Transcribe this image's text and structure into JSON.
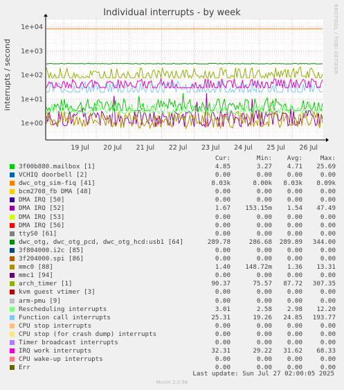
{
  "title": "Individual interrupts - by week",
  "ylabel": "interrupts / second",
  "side_text": "RRDTOOL / TOBI OETIKER",
  "footer": {
    "last_update": "Last update: Sun Jul 27 02:00:05 2025",
    "munin": "Munin 2.0.56"
  },
  "legend_headers": [
    "Cur:",
    "Min:",
    "Avg:",
    "Max:"
  ],
  "chart_data": {
    "type": "line",
    "title": "Individual interrupts - by week",
    "ylabel": "interrupts / second",
    "yscale": "log",
    "ylim": [
      0.2,
      20000
    ],
    "yticks": [
      "1e+00",
      "1e+01",
      "1e+02",
      "1e+03",
      "1e+04"
    ],
    "ytick_values": [
      1,
      10,
      100,
      1000,
      10000
    ],
    "xticks": [
      "19 Jul",
      "20 Jul",
      "21 Jul",
      "22 Jul",
      "23 Jul",
      "24 Jul",
      "25 Jul",
      "26 Jul"
    ],
    "grid": true,
    "series": [
      {
        "name": "3f00b880.mailbox [1]",
        "color": "#00cc00",
        "cur": "4.85",
        "min": "3.27",
        "avg": "4.71",
        "max": "25.69",
        "avg_value": 4.71,
        "min_value": 3.27,
        "max_value": 25.69
      },
      {
        "name": "VCHIQ doorbell [2]",
        "color": "#0066b3",
        "cur": "0.00",
        "min": "0.00",
        "avg": "0.00",
        "max": "0.00",
        "avg_value": 0,
        "min_value": 0,
        "max_value": 0
      },
      {
        "name": "dwc_otg_sim-fiq [41]",
        "color": "#ff8000",
        "cur": "8.03k",
        "min": "8.00k",
        "avg": "8.03k",
        "max": "8.09k",
        "avg_value": 8030,
        "min_value": 8000,
        "max_value": 8090
      },
      {
        "name": "bcm2708_fb DMA [48]",
        "color": "#ffcc00",
        "cur": "0.00",
        "min": "0.00",
        "avg": "0.00",
        "max": "0.00",
        "avg_value": 0,
        "min_value": 0,
        "max_value": 0
      },
      {
        "name": "DMA IRQ [50]",
        "color": "#330099",
        "cur": "0.00",
        "min": "0.00",
        "avg": "0.00",
        "max": "0.00",
        "avg_value": 0,
        "min_value": 0,
        "max_value": 0
      },
      {
        "name": "DMA IRQ [52]",
        "color": "#990099",
        "cur": "1.67",
        "min": "153.15m",
        "avg": "1.54",
        "max": "47.49",
        "avg_value": 1.54,
        "min_value": 0.15315,
        "max_value": 47.49
      },
      {
        "name": "DMA IRQ [53]",
        "color": "#ccff00",
        "cur": "0.00",
        "min": "0.00",
        "avg": "0.00",
        "max": "0.00",
        "avg_value": 0,
        "min_value": 0,
        "max_value": 0
      },
      {
        "name": "DMA IRQ [56]",
        "color": "#ff0000",
        "cur": "0.00",
        "min": "0.00",
        "avg": "0.00",
        "max": "0.00",
        "avg_value": 0,
        "min_value": 0,
        "max_value": 0
      },
      {
        "name": "ttyS0 [61]",
        "color": "#808080",
        "cur": "0.00",
        "min": "0.00",
        "avg": "0.00",
        "max": "0.00",
        "avg_value": 0,
        "min_value": 0,
        "max_value": 0
      },
      {
        "name": "dwc_otg, dwc_otg_pcd, dwc_otg_hcd:usb1 [64]",
        "color": "#008f00",
        "cur": "289.78",
        "min": "286.68",
        "avg": "289.89",
        "max": "344.00",
        "avg_value": 289.89,
        "min_value": 286.68,
        "max_value": 344.0
      },
      {
        "name": "3f804000.i2c [85]",
        "color": "#00487d",
        "cur": "0.00",
        "min": "0.00",
        "avg": "0.00",
        "max": "0.00",
        "avg_value": 0,
        "min_value": 0,
        "max_value": 0
      },
      {
        "name": "3f204000.spi [86]",
        "color": "#b35a00",
        "cur": "0.00",
        "min": "0.00",
        "avg": "0.00",
        "max": "0.00",
        "avg_value": 0,
        "min_value": 0,
        "max_value": 0
      },
      {
        "name": "mmc0 [88]",
        "color": "#b38f00",
        "cur": "1.40",
        "min": "148.72m",
        "avg": "1.36",
        "max": "13.31",
        "avg_value": 1.36,
        "min_value": 0.14872,
        "max_value": 13.31
      },
      {
        "name": "mmc1 [94]",
        "color": "#6b006b",
        "cur": "0.00",
        "min": "0.00",
        "avg": "0.00",
        "max": "0.00",
        "avg_value": 0,
        "min_value": 0,
        "max_value": 0
      },
      {
        "name": "arch_timer [1]",
        "color": "#8fb300",
        "cur": "90.37",
        "min": "75.57",
        "avg": "87.72",
        "max": "307.35",
        "avg_value": 87.72,
        "min_value": 75.57,
        "max_value": 307.35
      },
      {
        "name": "kvm guest vtimer [3]",
        "color": "#b30000",
        "cur": "0.00",
        "min": "0.00",
        "avg": "0.00",
        "max": "0.00",
        "avg_value": 0,
        "min_value": 0,
        "max_value": 0
      },
      {
        "name": "arm-pmu [9]",
        "color": "#bebebe",
        "cur": "0.00",
        "min": "0.00",
        "avg": "0.00",
        "max": "0.00",
        "avg_value": 0,
        "min_value": 0,
        "max_value": 0
      },
      {
        "name": "Rescheduling interrupts",
        "color": "#80ff80",
        "cur": "3.01",
        "min": "2.58",
        "avg": "2.98",
        "max": "12.20",
        "avg_value": 2.98,
        "min_value": 2.58,
        "max_value": 12.2
      },
      {
        "name": "Function call interrupts",
        "color": "#80c9ff",
        "cur": "25.31",
        "min": "19.26",
        "avg": "24.85",
        "max": "193.77",
        "avg_value": 24.85,
        "min_value": 19.26,
        "max_value": 193.77
      },
      {
        "name": "CPU stop interrupts",
        "color": "#ffc080",
        "cur": "0.00",
        "min": "0.00",
        "avg": "0.00",
        "max": "0.00",
        "avg_value": 0,
        "min_value": 0,
        "max_value": 0
      },
      {
        "name": "CPU stop (for crash dump) interrupts",
        "color": "#ffe680",
        "cur": "0.00",
        "min": "0.00",
        "avg": "0.00",
        "max": "0.00",
        "avg_value": 0,
        "min_value": 0,
        "max_value": 0
      },
      {
        "name": "Timer broadcast interrupts",
        "color": "#aa80ff",
        "cur": "0.00",
        "min": "0.00",
        "avg": "0.00",
        "max": "0.00",
        "avg_value": 0,
        "min_value": 0,
        "max_value": 0
      },
      {
        "name": "IRQ work interrupts",
        "color": "#ee00cc",
        "cur": "32.31",
        "min": "29.22",
        "avg": "31.62",
        "max": "68.33",
        "avg_value": 31.62,
        "min_value": 29.22,
        "max_value": 68.33
      },
      {
        "name": "CPU wake-up interrupts",
        "color": "#ff8080",
        "cur": "0.00",
        "min": "0.00",
        "avg": "0.00",
        "max": "0.00",
        "avg_value": 0,
        "min_value": 0,
        "max_value": 0
      },
      {
        "name": "Err",
        "color": "#666600",
        "cur": "0.00",
        "min": "0.00",
        "avg": "0.00",
        "max": "0.00",
        "avg_value": 0,
        "min_value": 0,
        "max_value": 0
      }
    ]
  }
}
